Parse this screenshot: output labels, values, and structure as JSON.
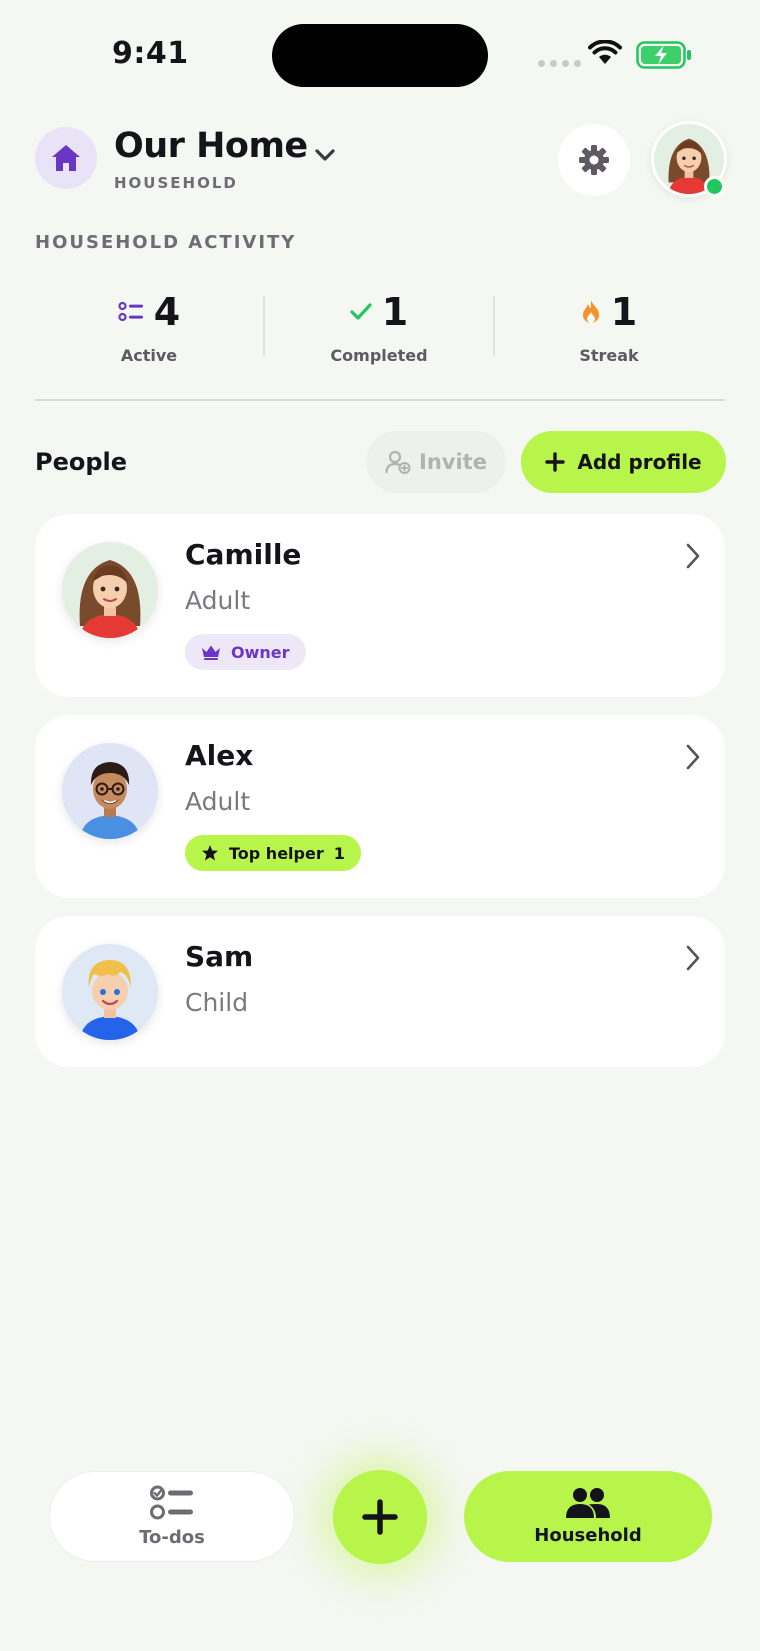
{
  "status_bar": {
    "time": "9:41"
  },
  "header": {
    "title": "Our Home",
    "subtitle": "HOUSEHOLD",
    "home_icon": "house-icon",
    "settings_icon": "gear-icon",
    "online_status_color": "#22c55e"
  },
  "activity": {
    "label": "HOUSEHOLD ACTIVITY",
    "stats": [
      {
        "value": "4",
        "label": "Active",
        "icon": "list-icon",
        "color": "#6b36c4"
      },
      {
        "value": "1",
        "label": "Completed",
        "icon": "checkmark-icon",
        "color": "#22c55e"
      },
      {
        "value": "1",
        "label": "Streak",
        "icon": "flame-icon",
        "color": "#f5922b"
      }
    ]
  },
  "people": {
    "title": "People",
    "invite_label": "Invite",
    "add_profile_label": "Add profile",
    "members": [
      {
        "name": "Camille",
        "role": "Adult",
        "badge": "Owner",
        "badge_icon": "crown-icon"
      },
      {
        "name": "Alex",
        "role": "Adult",
        "badge": "Top helper",
        "badge_count": "1",
        "badge_icon": "star-icon"
      },
      {
        "name": "Sam",
        "role": "Child"
      }
    ]
  },
  "bottom_nav": {
    "todos_label": "To-dos",
    "household_label": "Household",
    "accent_color": "#b8f54a"
  }
}
